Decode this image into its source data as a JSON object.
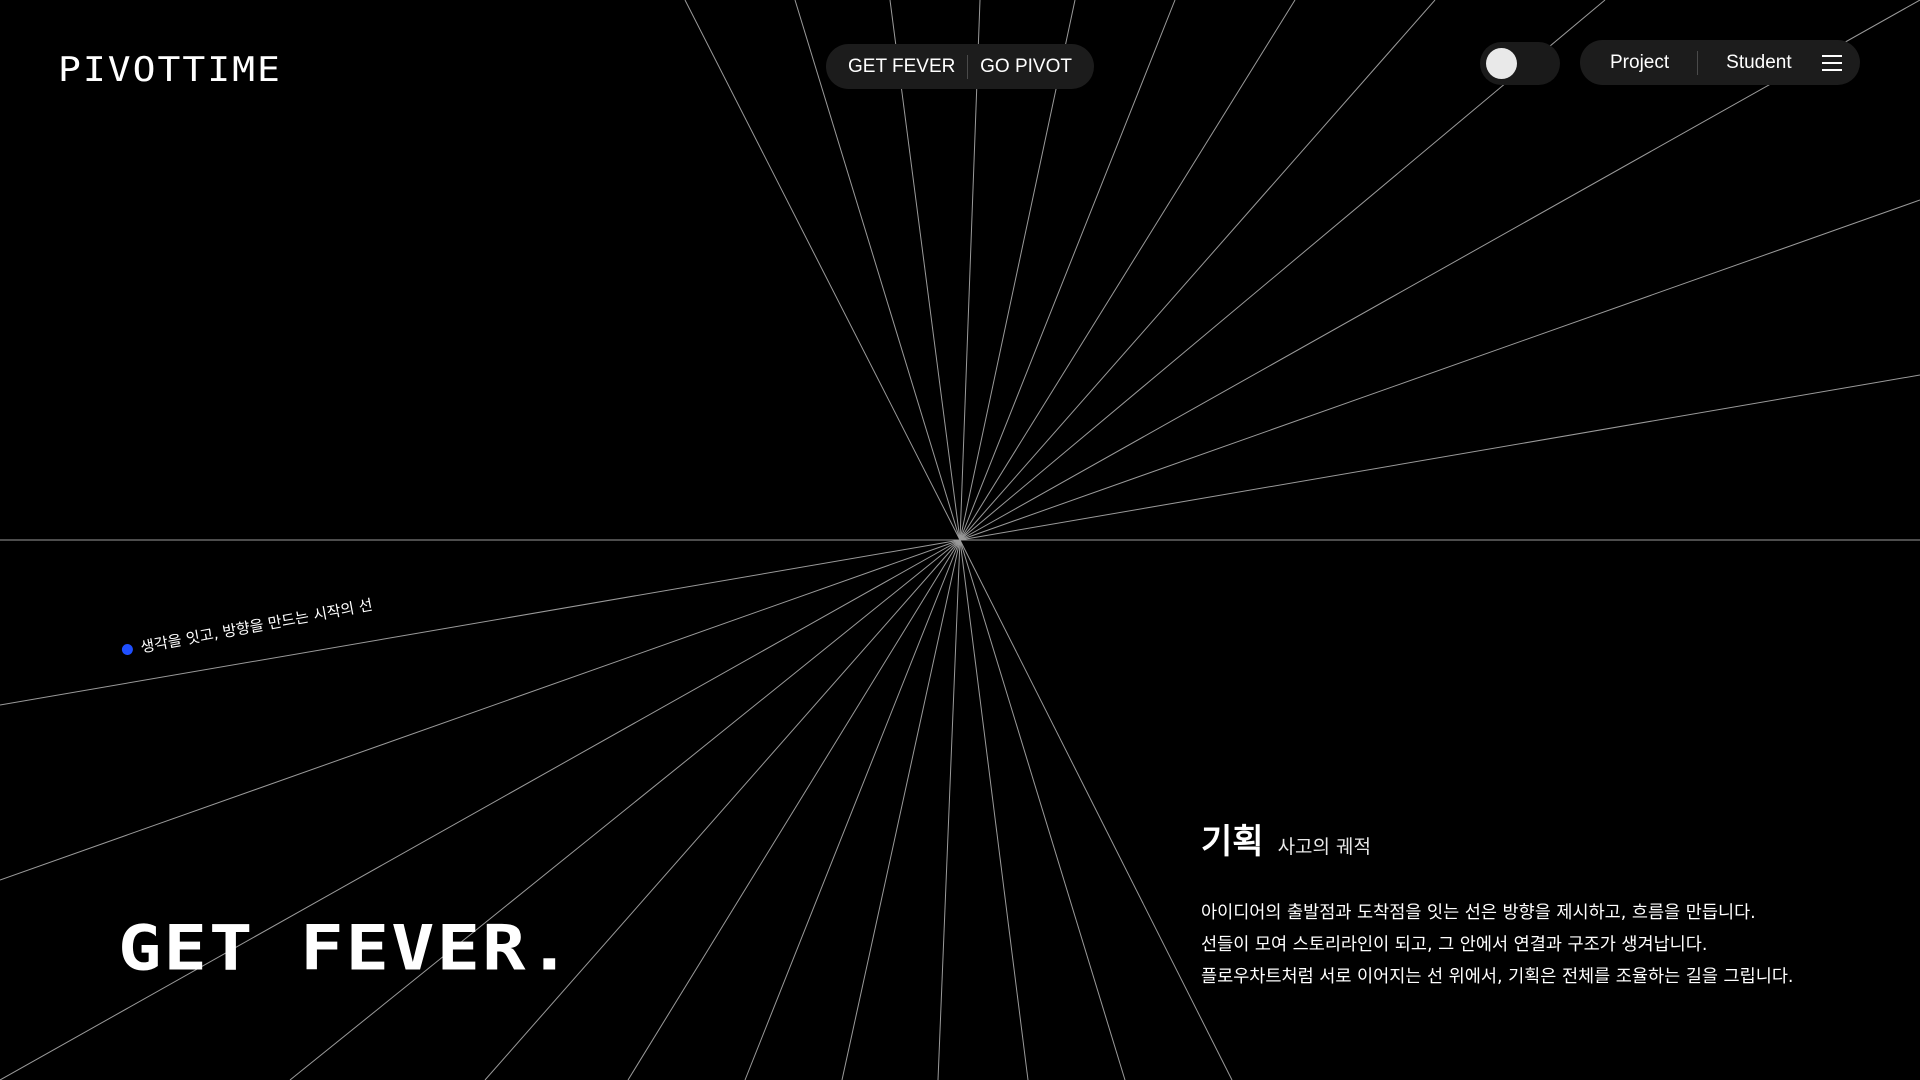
{
  "header": {
    "logo": "PIVOTTIME",
    "center_nav": [
      "GET FEVER",
      "GO PIVOT"
    ],
    "right_nav": [
      "Project",
      "Student"
    ],
    "menu_icon": "hamburger-menu-icon",
    "theme_toggle_icon": "toggle-switch-icon"
  },
  "caption": {
    "text": "생각을 잇고, 방향을 만드는 시작의 선",
    "dot_color": "#1f4fff"
  },
  "hero": {
    "title": "GET FEVER."
  },
  "section": {
    "heading": "기획",
    "subheading": "사고의 궤적",
    "body": [
      "아이디어의 출발점과 도착점을 잇는 선은 방향을 제시하고, 흐름을 만듭니다.",
      "선들이 모여 스토리라인이 되고, 그 안에서 연결과 구조가 생겨납니다.",
      "플로우차트처럼 서로 이어지는 선 위에서, 기획은 전체를 조율하는 길을 그립니다."
    ]
  },
  "colors": {
    "background": "#000000",
    "text": "#ffffff",
    "line": "#9a9a9a",
    "pill": "#1c1c1c",
    "accent": "#1f4fff"
  }
}
